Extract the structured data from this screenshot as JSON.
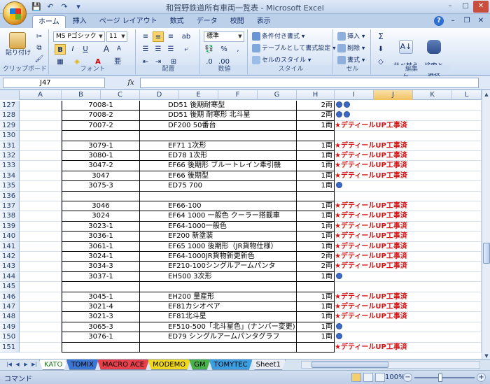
{
  "window": {
    "title": "和賀野鉄道所有車両一覧表 - Microsoft Excel",
    "controls": [
      "–",
      "□",
      "✕"
    ]
  },
  "quick_access": {
    "save": "💾",
    "undo": "↶",
    "redo": "↷",
    "more": "▾"
  },
  "ribbon_tabs": [
    "ホーム",
    "挿入",
    "ページ レイアウト",
    "数式",
    "データ",
    "校閲",
    "表示"
  ],
  "ribbon": {
    "clipboard": {
      "label": "クリップボード",
      "paste": "貼り付け"
    },
    "font": {
      "label": "フォント",
      "name": "MS Pゴシック",
      "size": "11",
      "bold": "B",
      "italic": "I",
      "underline": "U",
      "grow": "A",
      "shrink": "A"
    },
    "alignment": {
      "label": "配置"
    },
    "number": {
      "label": "数値",
      "format": "標準",
      "percent": "%",
      "comma": ","
    },
    "styles": {
      "label": "スタイル",
      "conditional": "条件付き書式",
      "as_table": "テーブルとして書式設定",
      "cell_styles": "セルのスタイル"
    },
    "cells": {
      "label": "セル",
      "insert": "挿入",
      "delete": "削除",
      "format": "書式"
    },
    "editing": {
      "label": "編集",
      "sum": "Σ",
      "sort": "並べ替えと\nフィルタ",
      "find": "検索と\n選択"
    }
  },
  "formula_bar": {
    "name_box": "J47",
    "fx": "fx",
    "value": ""
  },
  "columns": [
    "A",
    "B",
    "C",
    "D",
    "E",
    "F",
    "G",
    "H",
    "I",
    "J",
    "K",
    "L"
  ],
  "selected_column": "J",
  "status_label": "★デティールUP工事済",
  "rows": [
    {
      "n": "127",
      "code": "7008-1",
      "name": "DD51 後期耐寒型",
      "qty": "2両",
      "mark": "dots2"
    },
    {
      "n": "128",
      "code": "7008-2",
      "name": "DD51 後期 耐寒形 北斗星",
      "qty": "2両",
      "mark": "dots2"
    },
    {
      "n": "129",
      "code": "7007-2",
      "name": "DF200  50番台",
      "qty": "1両",
      "mark": "star"
    },
    {
      "n": "130",
      "code": "",
      "name": "",
      "qty": "",
      "mark": ""
    },
    {
      "n": "131",
      "code": "3079-1",
      "name": "EF71 1次形",
      "qty": "1両",
      "mark": "star"
    },
    {
      "n": "132",
      "code": "3080-1",
      "name": "ED78 1次形",
      "qty": "1両",
      "mark": "star"
    },
    {
      "n": "133",
      "code": "3047-2",
      "name": "EF66 後期形 ブルートレイン牽引機",
      "qty": "1両",
      "mark": "star"
    },
    {
      "n": "134",
      "code": "3047",
      "name": "EF66  後期型",
      "qty": "1両",
      "mark": "star"
    },
    {
      "n": "135",
      "code": "3075-3",
      "name": "ED75 700",
      "qty": "1両",
      "mark": "dot"
    },
    {
      "n": "136",
      "code": "",
      "name": "",
      "qty": "",
      "mark": ""
    },
    {
      "n": "137",
      "code": "3046",
      "name": "EF66-100",
      "qty": "1両",
      "mark": "star"
    },
    {
      "n": "138",
      "code": "3024",
      "name": "EF64 1000 一般色 クーラー搭載車",
      "qty": "1両",
      "mark": "star"
    },
    {
      "n": "139",
      "code": "3023-1",
      "name": "EF64-1000一般色",
      "qty": "1両",
      "mark": "star"
    },
    {
      "n": "140",
      "code": "3036-1",
      "name": "EF200  新塗装",
      "qty": "1両",
      "mark": "star"
    },
    {
      "n": "141",
      "code": "3061-1",
      "name": "EF65 1000 後期形（JR貨物仕様）",
      "qty": "1両",
      "mark": "star"
    },
    {
      "n": "142",
      "code": "3024-1",
      "name": "EF64-1000JR貨物新更新色",
      "qty": "2両",
      "mark": "star"
    },
    {
      "n": "143",
      "code": "3034-3",
      "name": "EF210-100シングルアームパンタ",
      "qty": "2両",
      "mark": "star"
    },
    {
      "n": "144",
      "code": "3037-1",
      "name": "EH500  3次形",
      "qty": "1両",
      "mark": "dot"
    },
    {
      "n": "145",
      "code": "",
      "name": "",
      "qty": "",
      "mark": ""
    },
    {
      "n": "146",
      "code": "3045-1",
      "name": "EH200 量産形",
      "qty": "1両",
      "mark": "star"
    },
    {
      "n": "147",
      "code": "3021-4",
      "name": "EF81カシオペア",
      "qty": "1両",
      "mark": "star"
    },
    {
      "n": "148",
      "code": "3021-3",
      "name": "EF81北斗星",
      "qty": "1両",
      "mark": "star"
    },
    {
      "n": "149",
      "code": "3065-3",
      "name": "EF510-500「北斗星色」(ナンバー変更)",
      "qty": "1両",
      "mark": "dot"
    },
    {
      "n": "150",
      "code": "3076-1",
      "name": "ED79 シングルアームパンタグラフ",
      "qty": "1両",
      "mark": "dot"
    },
    {
      "n": "151",
      "code": "",
      "name": "",
      "qty": "",
      "mark": "star"
    }
  ],
  "sheet_tabs": [
    {
      "name": "KATO",
      "color": "#ffffff"
    },
    {
      "name": "TOMIX",
      "color": "#3a76d4"
    },
    {
      "name": "MACRO ACE",
      "color": "#e8404a"
    },
    {
      "name": "MODEMO",
      "color": "#f0d820"
    },
    {
      "name": "GM",
      "color": "#4ab04a"
    },
    {
      "name": "TOMYTEC",
      "color": "#3a9ee0"
    },
    {
      "name": "Sheet1",
      "color": "#e9eef6"
    }
  ],
  "status_bar": {
    "mode": "コマンド",
    "zoom": "100%"
  }
}
